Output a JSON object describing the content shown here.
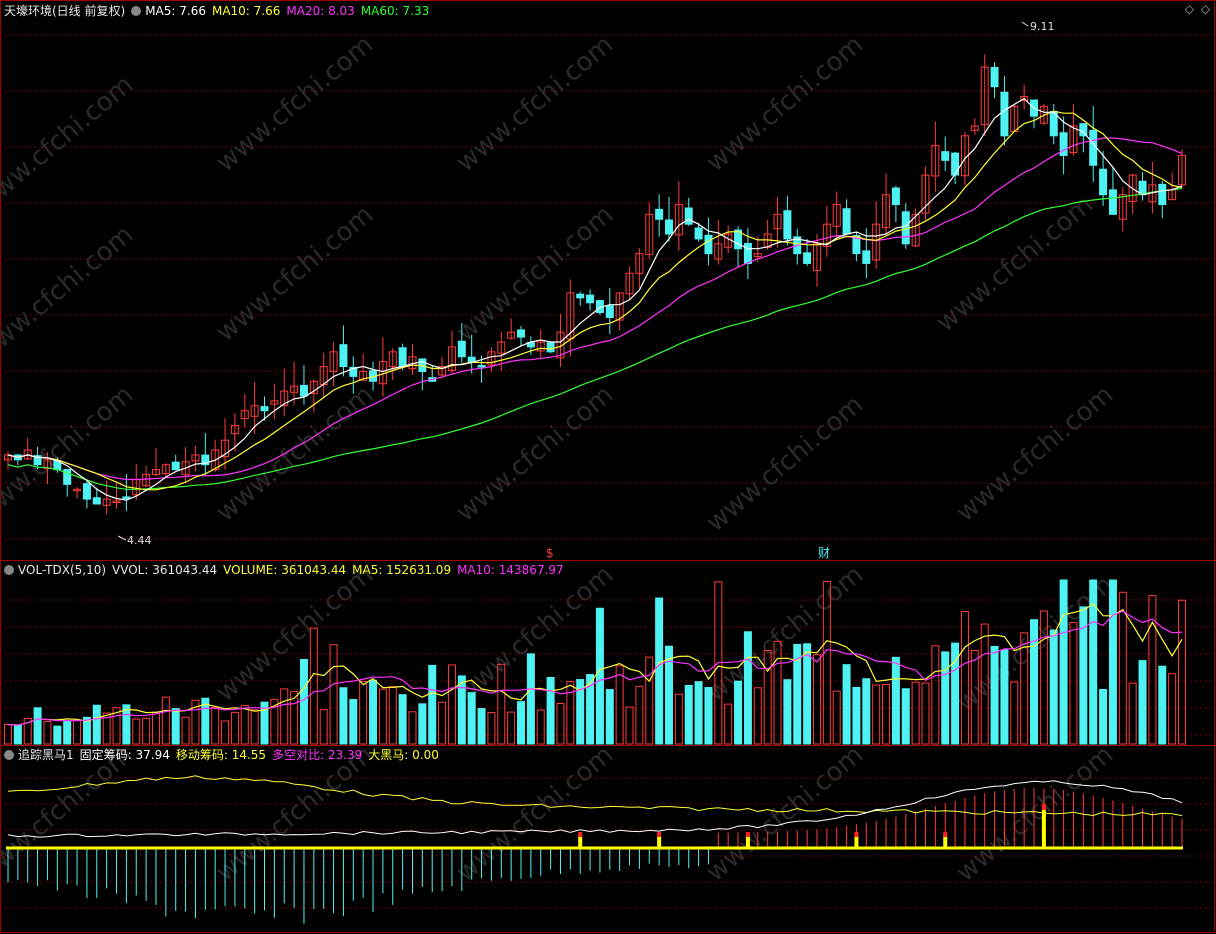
{
  "main_header": {
    "stock": "天壕环境(日线 前复权)",
    "ma5": "MA5: 7.66",
    "ma10": "MA10: 7.66",
    "ma20": "MA20: 8.03",
    "ma60": "MA60: 7.33"
  },
  "vol_header": {
    "name": "VOL-TDX(5,10)",
    "vvol": "VVOL: 361043.44",
    "volume": "VOLUME: 361043.44",
    "ma5": "MA5: 152631.09",
    "ma10": "MA10: 143867.97"
  },
  "ind_header": {
    "name": "追踪黑马1",
    "fixed": "固定筹码: 37.94",
    "moving": "移动筹码: 14.55",
    "ratio": "多空对比: 23.39",
    "horse": "大黑马: 0.00"
  },
  "watermark": "www.cfchi.com",
  "markers": {
    "high_label": "9.11",
    "low_label": "4.44",
    "event1": "$",
    "event2": "财"
  },
  "colors": {
    "up": "#ff3b3b",
    "down": "#4ef2f2",
    "ma5": "#ffffff",
    "ma10": "#ffff33",
    "ma20": "#ff33ff",
    "ma60": "#33ff33",
    "grid": "#7a0000",
    "border": "#a00000"
  },
  "chart_data": [
    {
      "type": "candlestick",
      "title": "天壕环境(日线 前复权)",
      "price_range": [
        4.0,
        9.5
      ],
      "high": 9.11,
      "low": 4.44,
      "closes": [
        5.05,
        5.0,
        5.1,
        4.95,
        5.0,
        4.9,
        4.75,
        4.7,
        4.6,
        4.55,
        4.6,
        4.58,
        4.62,
        4.8,
        4.85,
        4.9,
        4.95,
        4.9,
        4.98,
        5.05,
        4.95,
        5.1,
        5.2,
        5.35,
        5.5,
        5.55,
        5.5,
        5.6,
        5.7,
        5.75,
        5.65,
        5.8,
        5.95,
        6.1,
        5.95,
        5.85,
        5.9,
        5.8,
        6.0,
        6.1,
        5.95,
        6.05,
        5.9,
        5.8,
        5.95,
        6.15,
        6.05,
        6.0,
        5.95,
        6.1,
        6.2,
        6.3,
        6.25,
        6.15,
        6.2,
        6.1,
        6.3,
        6.7,
        6.65,
        6.6,
        6.5,
        6.45,
        6.7,
        6.9,
        7.1,
        7.5,
        7.45,
        7.3,
        7.6,
        7.4,
        7.25,
        7.1,
        7.2,
        7.3,
        7.15,
        7.0,
        7.1,
        7.3,
        7.5,
        7.25,
        7.1,
        7.0,
        7.2,
        7.4,
        7.6,
        7.3,
        7.1,
        7.0,
        7.4,
        7.7,
        7.6,
        7.2,
        7.5,
        7.9,
        8.2,
        8.05,
        7.9,
        8.3,
        8.4,
        9.0,
        8.8,
        8.3,
        8.6,
        8.7,
        8.5,
        8.6,
        8.3,
        8.1,
        8.4,
        8.3,
        8.0,
        7.7,
        7.5,
        7.7,
        7.9,
        7.7,
        7.8,
        7.6,
        7.75,
        8.1
      ],
      "ma_lines": [
        "MA5",
        "MA10",
        "MA20",
        "MA60"
      ]
    },
    {
      "type": "bar",
      "title": "VOL-TDX(5,10)",
      "series_note": "volume bars",
      "volume_last": 361043.44,
      "ma5": 152631.09,
      "ma10": 143867.97
    },
    {
      "type": "line",
      "title": "追踪黑马1",
      "series": [
        {
          "name": "固定筹码",
          "last": 37.94
        },
        {
          "name": "移动筹码",
          "last": 14.55
        },
        {
          "name": "多空对比",
          "last": 23.39
        },
        {
          "name": "大黑马",
          "last": 0.0
        }
      ]
    }
  ]
}
